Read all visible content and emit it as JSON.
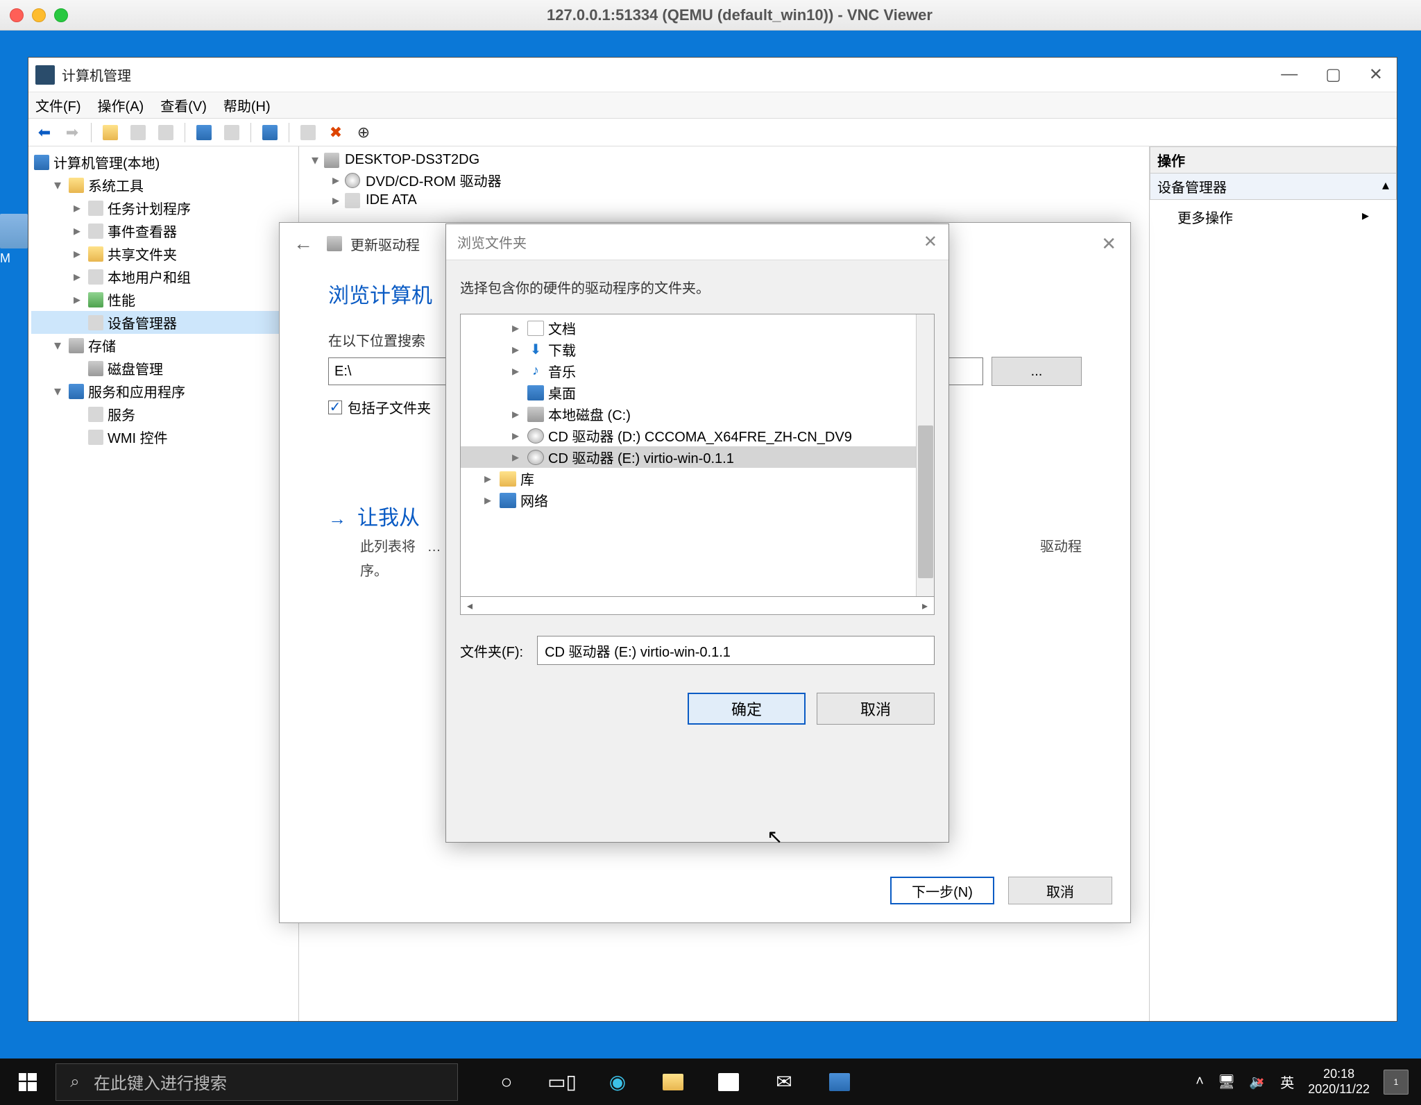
{
  "vnc": {
    "title": "127.0.0.1:51334 (QEMU (default_win10)) - VNC Viewer"
  },
  "desktop_partial_icon_label": "M",
  "cmgmt": {
    "title": "计算机管理",
    "menu": {
      "file": "文件(F)",
      "action": "操作(A)",
      "view": "查看(V)",
      "help": "帮助(H)"
    },
    "tree": {
      "root": "计算机管理(本地)",
      "system_tools": "系统工具",
      "task_scheduler": "任务计划程序",
      "event_viewer": "事件查看器",
      "shared_folders": "共享文件夹",
      "local_users": "本地用户和组",
      "performance": "性能",
      "device_manager": "设备管理器",
      "storage": "存储",
      "disk_mgmt": "磁盘管理",
      "services_apps": "服务和应用程序",
      "services": "服务",
      "wmi": "WMI 控件"
    },
    "devices": {
      "host": "DESKTOP-DS3T2DG",
      "dvd": "DVD/CD-ROM 驱动器",
      "ide": "IDE ATA"
    },
    "rightpane": {
      "header": "操作",
      "sub": "设备管理器",
      "more": "更多操作"
    }
  },
  "wizard": {
    "back_arrow": "←",
    "title_prefix": "更新驱动程",
    "heading_prefix": "浏览计算机",
    "search_label_prefix": "在以下位置搜索",
    "path": "E:\\",
    "browse_btn": "...",
    "include_sub": "包括子文件夹",
    "letme_title": "让我从",
    "letme_desc_1": "此列表将",
    "letme_desc_2": "驱动程",
    "letme_desc_3": "序。",
    "next": "下一步(N)",
    "cancel": "取消"
  },
  "browse": {
    "title": "浏览文件夹",
    "instruction": "选择包含你的硬件的驱动程序的文件夹。",
    "tree": {
      "documents": "文档",
      "downloads": "下载",
      "music": "音乐",
      "desktop": "桌面",
      "local_disk_c": "本地磁盘 (C:)",
      "cd_d": "CD 驱动器 (D:) CCCOMA_X64FRE_ZH-CN_DV9",
      "cd_e": "CD 驱动器 (E:) virtio-win-0.1.1",
      "libraries": "库",
      "network": "网络"
    },
    "folder_label": "文件夹(F):",
    "folder_value": "CD 驱动器 (E:) virtio-win-0.1.1",
    "ok": "确定",
    "cancel": "取消"
  },
  "taskbar": {
    "search_placeholder": "在此键入进行搜索",
    "ime": "英",
    "time": "20:18",
    "date": "2020/11/22",
    "notif_count": "1"
  }
}
